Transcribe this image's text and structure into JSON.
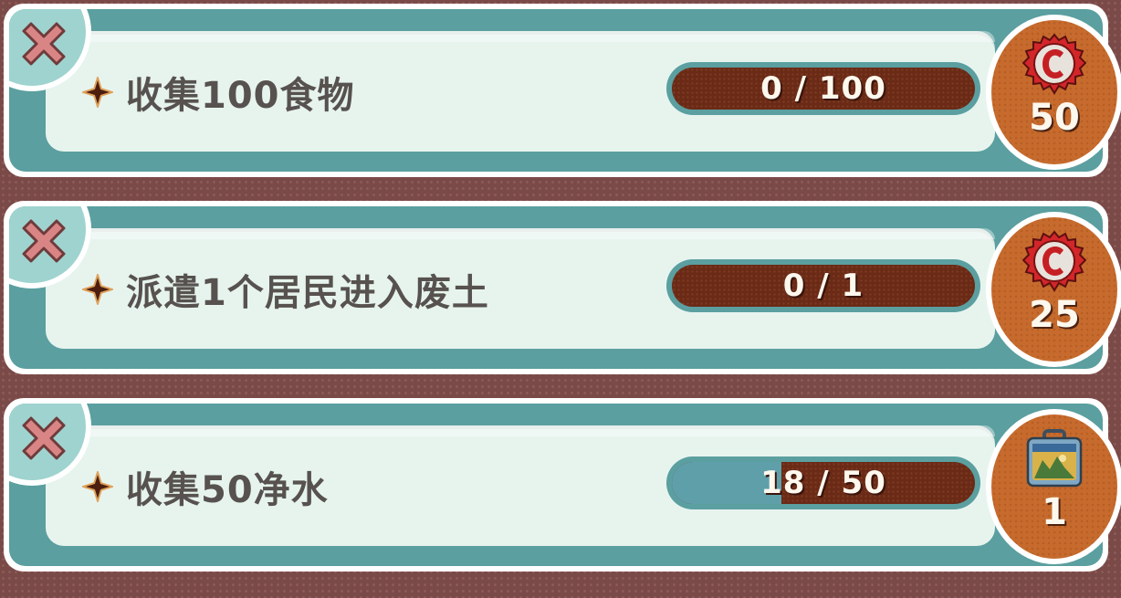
{
  "colors": {
    "card_border": "#ffffff",
    "card_teal": "#5b9fa0",
    "panel_bg": "#e7f4ee",
    "progress_track": "#6a2a16",
    "progress_fill": "#5f9faa",
    "reward_orange": "#c66b2d",
    "close_x": "#d98585",
    "task_text": "#57524f"
  },
  "objectives": [
    {
      "label": "收集100食物",
      "progress_text": "0 / 100",
      "progress_fraction": 0.0,
      "reward_icon": "bottle-cap-icon",
      "reward_amount": "50"
    },
    {
      "label": "派遣1个居民进入废土",
      "progress_text": "0 / 1",
      "progress_fraction": 0.0,
      "reward_icon": "bottle-cap-icon",
      "reward_amount": "25"
    },
    {
      "label": "收集50净水",
      "progress_text": "18 / 50",
      "progress_fraction": 0.36,
      "reward_icon": "lunchbox-icon",
      "reward_amount": "1"
    }
  ]
}
